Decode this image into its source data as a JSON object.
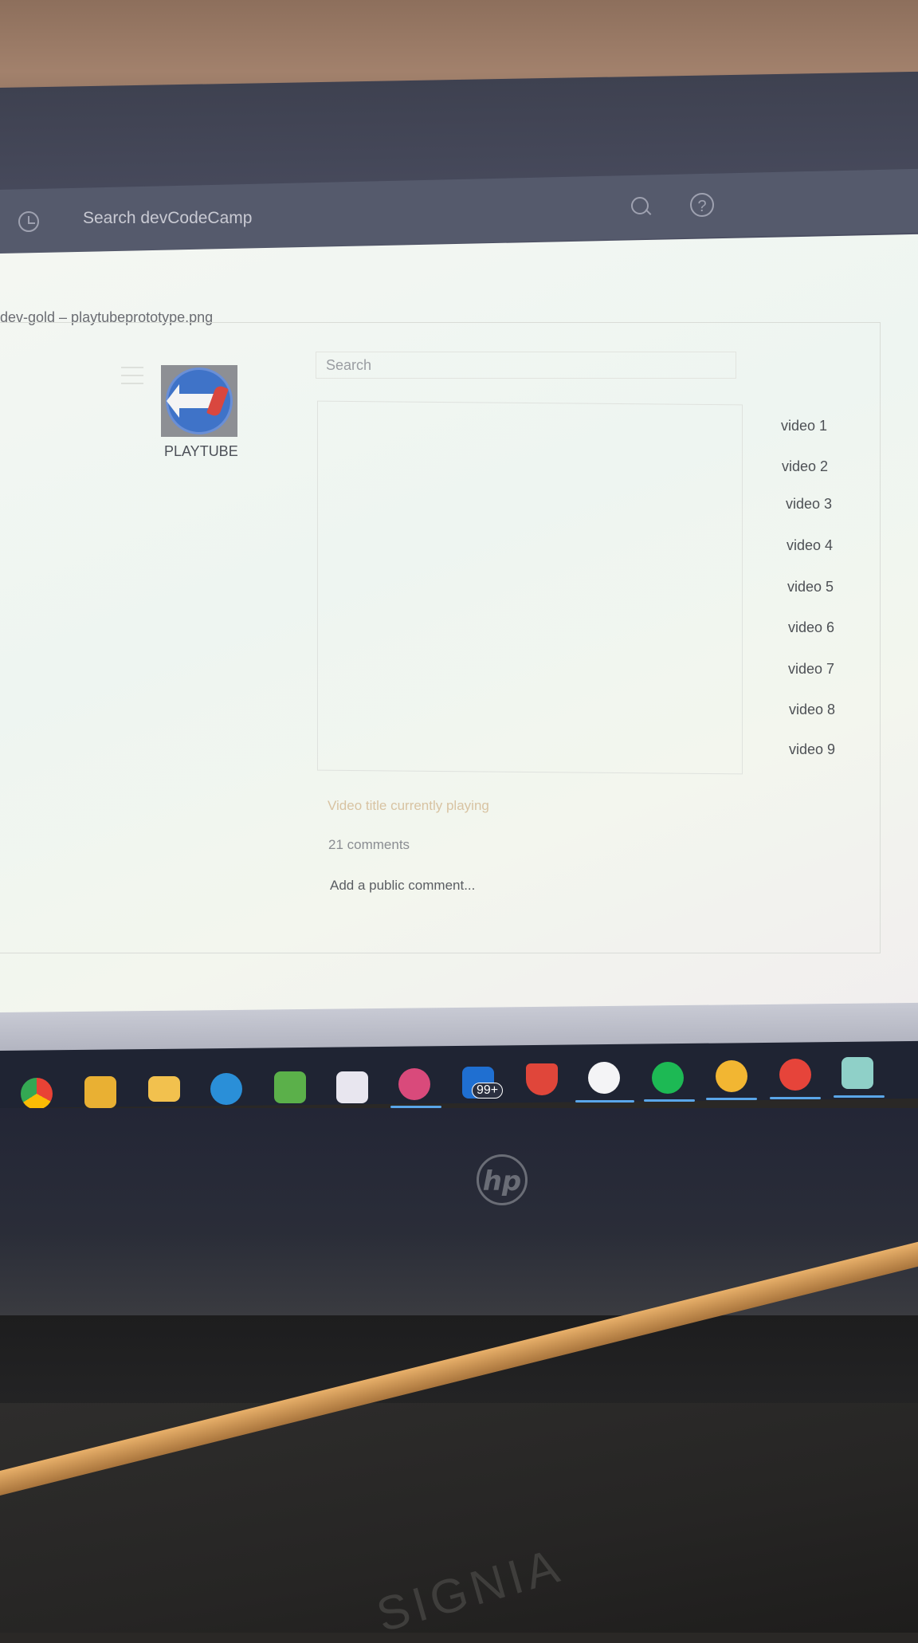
{
  "top_bar": {
    "search_placeholder": "Search devCodeCamp"
  },
  "window": {
    "title": "dev-gold  – playtubeprototype.png"
  },
  "prototype": {
    "logo_text": "PLAYTUBE",
    "search_placeholder": "Search",
    "videos": [
      "video 1",
      "video 2",
      "video 3",
      "video 4",
      "video 5",
      "video 6",
      "video 7",
      "video 8",
      "video 9"
    ],
    "now_playing": "Video title currently playing",
    "comment_count": "21 comments",
    "comment_placeholder": "Add a public comment..."
  },
  "taskbar": {
    "mail_badge": "99+",
    "apps": [
      "chrome-icon",
      "gimp-icon",
      "file-explorer-icon",
      "edge-icon",
      "camtasia-icon",
      "microsoft-store-icon",
      "app-icon",
      "mail-icon",
      "brave-icon",
      "slack-icon",
      "spotify-icon",
      "messenger-icon",
      "pen-icon",
      "notes-icon"
    ]
  },
  "device": {
    "logo": "hp",
    "monitor_brand": "SIGNIA"
  },
  "colors": {
    "accent_line": "#5aa6e8",
    "now_playing": "#d8c3a2",
    "window_bg": "#f4f7f2"
  }
}
